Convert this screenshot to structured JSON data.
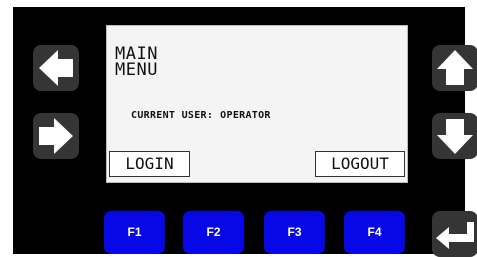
{
  "screen": {
    "title_lines": [
      "MAIN",
      "MENU"
    ],
    "status_label": "CURRENT USER:",
    "status_value": "OPERATOR",
    "soft_key_left": "LOGIN",
    "soft_key_right": "LOGOUT"
  },
  "function_keys": [
    "F1",
    "F2",
    "F3",
    "F4"
  ],
  "navigation_icons": {
    "left": "arrow-left-icon",
    "right": "arrow-right-icon",
    "up": "arrow-up-icon",
    "down": "arrow-down-icon",
    "enter": "enter-return-icon"
  },
  "colors": {
    "bezel": "#000000",
    "nav_button": "#353535",
    "function_key": "#0808e6",
    "screen_background": "#f4f4f4",
    "icon": "#ffffff"
  }
}
